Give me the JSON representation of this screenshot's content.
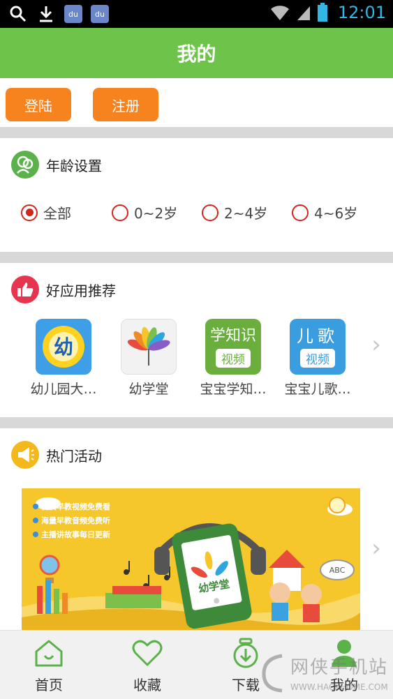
{
  "status_bar": {
    "time": "12:01",
    "notifications": [
      "search-icon",
      "download-icon",
      "baidu-icon",
      "baidu-icon"
    ],
    "baidu_text": "du"
  },
  "header": {
    "title": "我的"
  },
  "account": {
    "login_label": "登陆",
    "register_label": "注册"
  },
  "age_settings": {
    "title": "年龄设置",
    "options": [
      "全部",
      "0~2岁",
      "2~4岁",
      "4~6岁"
    ],
    "selected": "全部"
  },
  "recommended_apps": {
    "title": "好应用推荐",
    "apps": [
      {
        "name": "幼儿园大…",
        "tile_text": "幼"
      },
      {
        "name": "幼学堂",
        "tile_text": ""
      },
      {
        "name": "宝宝学知…",
        "tile_text_top": "学知识",
        "tile_text_bottom": "视频"
      },
      {
        "name": "宝宝儿歌…",
        "tile_text_top": "儿歌",
        "tile_text_bottom": "视频"
      }
    ]
  },
  "hot_activities": {
    "title": "热门活动",
    "banner": {
      "lines": [
        "优质早教视频免费看",
        "海量早教音频免费听",
        "主播讲故事每日更新"
      ],
      "logo_text": "幼学堂",
      "sign_text": "ABC"
    }
  },
  "bottom_nav": {
    "items": [
      {
        "label": "首页",
        "icon": "home-icon"
      },
      {
        "label": "收藏",
        "icon": "heart-icon"
      },
      {
        "label": "下载",
        "icon": "download-icon"
      },
      {
        "label": "我的",
        "icon": "user-icon"
      }
    ],
    "active": "我的"
  },
  "watermark": {
    "main": "网侠手机站",
    "url": "WWW.HACKHOME.COM"
  },
  "colors": {
    "header_green": "#6ec44a",
    "button_orange": "#f7831f",
    "radio_red": "#d4251d",
    "status_blue": "#33b5e5",
    "banner_yellow": "#f6c72a"
  }
}
